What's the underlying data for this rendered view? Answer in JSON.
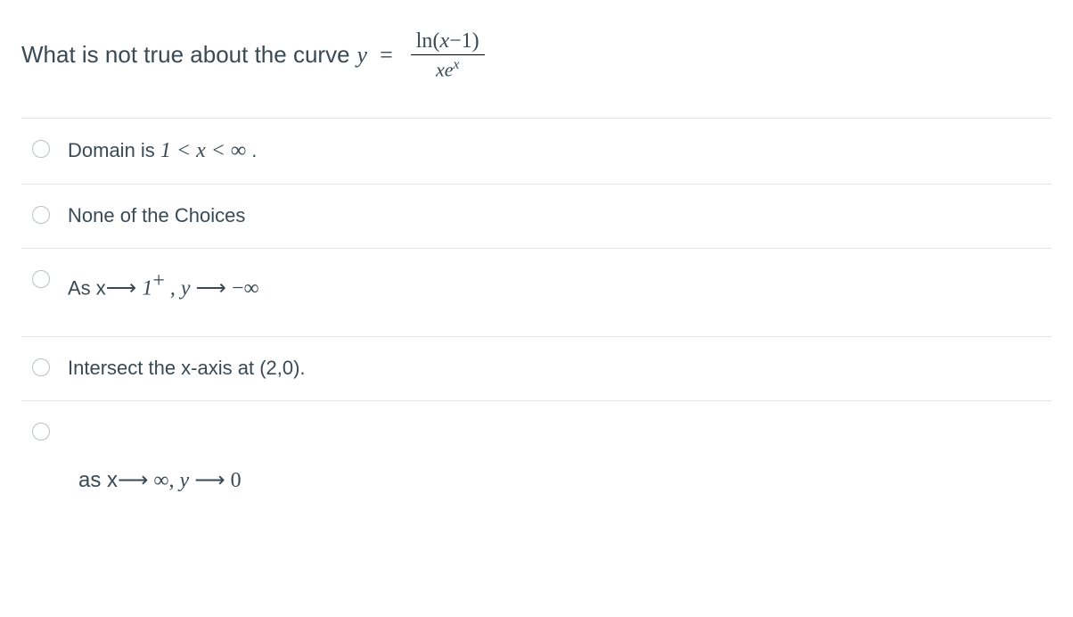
{
  "question": {
    "prefix": "What is not true about the curve ",
    "equation_y": "y",
    "equation_eq": "=",
    "frac_num_ln": "ln",
    "frac_num_paren_open": "(",
    "frac_num_x": "x",
    "frac_num_minus1": "−1",
    "frac_num_paren_close": ")",
    "frac_den_x": "x",
    "frac_den_e": "e",
    "frac_den_exp": "x"
  },
  "options": [
    {
      "id": "opt1",
      "prefix": "Domain is ",
      "math": "1 < x < ∞",
      "suffix": " ."
    },
    {
      "id": "opt2",
      "text": "None of the Choices"
    },
    {
      "id": "opt3",
      "prefix": "As x",
      "arrow1": "⟶",
      "one_plus": "1",
      "sup_plus": "+",
      "comma_y": " , y ",
      "arrow2": "⟶",
      "neg_inf": " −∞"
    },
    {
      "id": "opt4",
      "text": "Intersect the x-axis at (2,0)."
    },
    {
      "id": "opt5",
      "as_text": "as  x",
      "arrow1": "⟶",
      "inf": " ∞",
      "comma": ",   ",
      "y_text": "y ",
      "arrow2": "⟶",
      "zero": " 0"
    }
  ]
}
